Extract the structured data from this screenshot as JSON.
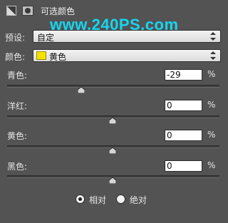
{
  "header": {
    "adjustment_icon": "adjustment-layer-icon",
    "mask_icon": "layer-mask-icon",
    "title": "可选颜色",
    "watermark": "www.240PS.com"
  },
  "preset": {
    "label": "预设:",
    "value": "自定"
  },
  "colors": {
    "label": "颜色:",
    "value": "黄色",
    "swatch_color": "#f5e100"
  },
  "sliders": [
    {
      "label": "青色:",
      "value": "-29",
      "unit": "%",
      "level": -29
    },
    {
      "label": "洋红:",
      "value": "0",
      "unit": "%",
      "level": 0
    },
    {
      "label": "黄色:",
      "value": "0",
      "unit": "%",
      "level": 0
    },
    {
      "label": "黑色:",
      "value": "0",
      "unit": "%",
      "level": 0
    }
  ],
  "method": {
    "relative": {
      "label": "相对",
      "selected": true
    },
    "absolute": {
      "label": "绝对",
      "selected": false
    }
  },
  "colors_accent": {
    "watermark": "#16d6f0",
    "panel_bg": "#535353"
  }
}
